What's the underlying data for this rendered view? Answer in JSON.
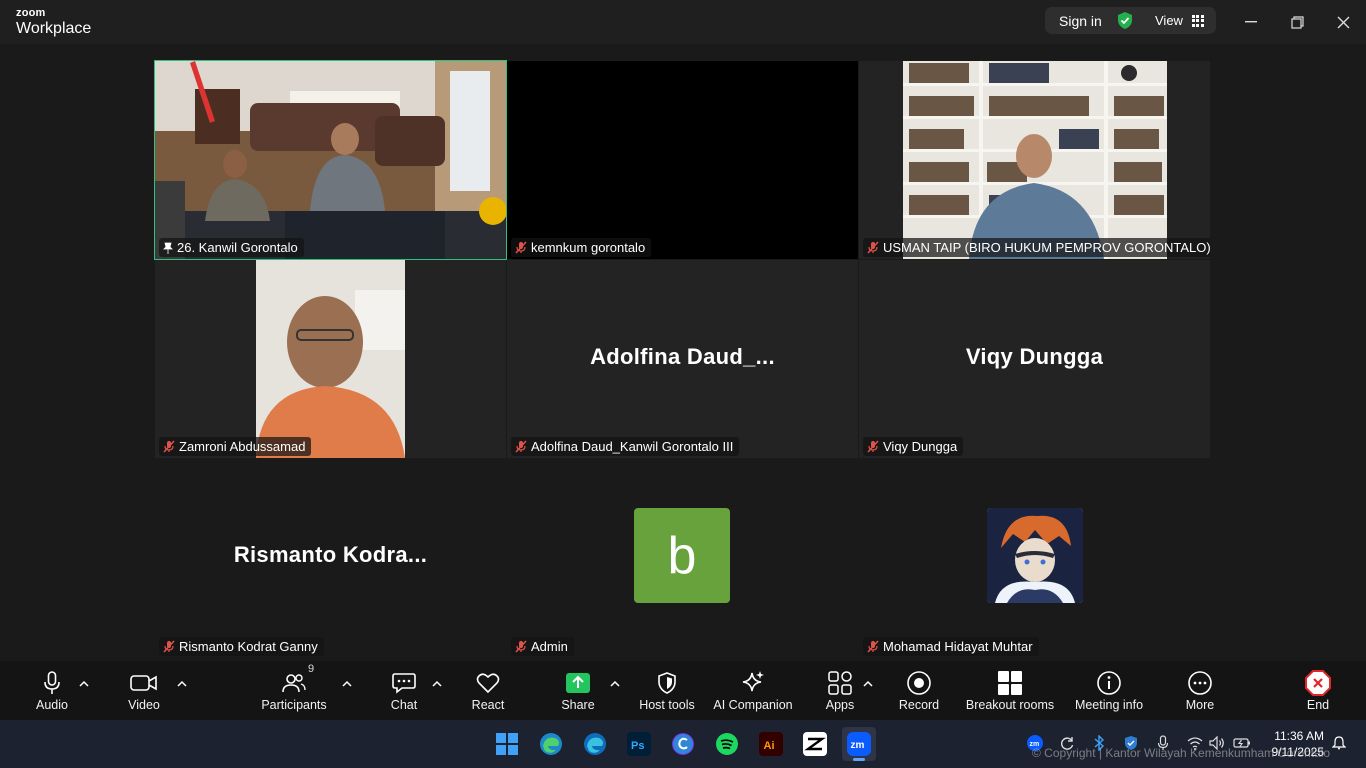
{
  "app": {
    "brand_top": "zoom",
    "brand_name": "Workplace"
  },
  "topbar": {
    "signin_label": "Sign in",
    "view_label": "View"
  },
  "tiles": [
    {
      "label": "26. Kanwil Gorontalo"
    },
    {
      "label": "kemnkum gorontalo"
    },
    {
      "label": "USMAN TAIP (BIRO HUKUM PEMPROV GORONTALO)"
    },
    {
      "label": "Zamroni Abdussamad"
    },
    {
      "label": "Adolfina Daud_Kanwil Gorontalo III",
      "display_name": "Adolfina  Daud_..."
    },
    {
      "label": "Viqy Dungga",
      "display_name": "Viqy Dungga"
    },
    {
      "label": "Rismanto Kodrat Ganny",
      "display_name": "Rismanto  Kodra..."
    },
    {
      "label": "Admin",
      "avatar_letter": "b"
    },
    {
      "label": "Mohamad Hidayat Muhtar"
    }
  ],
  "toolbar": {
    "audio": "Audio",
    "video": "Video",
    "participants": "Participants",
    "participants_count": "9",
    "chat": "Chat",
    "react": "React",
    "share": "Share",
    "host_tools": "Host tools",
    "ai_companion": "AI Companion",
    "apps": "Apps",
    "record": "Record",
    "breakout_rooms": "Breakout rooms",
    "meeting_info": "Meeting info",
    "more": "More",
    "end": "End"
  },
  "taskbar": {
    "time": "11:36 AM",
    "date": "9/11/2025",
    "watermark": "© Copyright | Kantor Wilayah Kemenkumham Gorontalo"
  },
  "colors": {
    "active_speaker": "#2ec27e",
    "mute_red": "#e0534d",
    "share_green": "#22c55e",
    "end_red": "#e02828",
    "avatar_green": "#68a23c"
  }
}
